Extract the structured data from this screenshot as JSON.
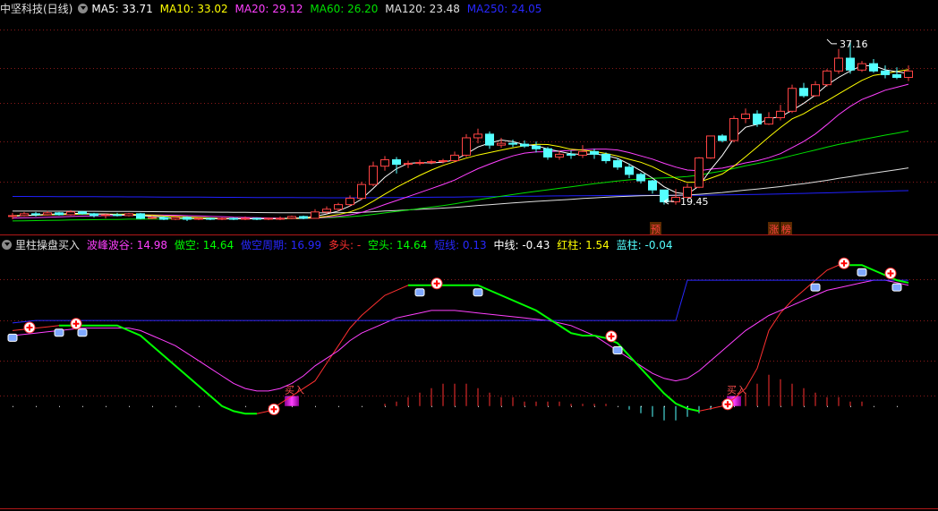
{
  "colors": {
    "background": "#000000",
    "grid": "#8b1a1a",
    "up": "#ff4444",
    "down": "#54ffff",
    "ma5": "#ffffff",
    "ma10": "#ffff00",
    "ma20": "#ff40ff",
    "ma60": "#00e000",
    "ma120": "#e0e0e0",
    "ma250": "#2020ff"
  },
  "top_header": {
    "title": "中坚科技(日线)",
    "ma5": "MA5: 33.71",
    "ma10": "MA10: 33.02",
    "ma20": "MA20: 29.12",
    "ma60": "MA60: 26.20",
    "ma120": "MA120: 23.48",
    "ma250": "MA250: 24.05"
  },
  "bottom_header": {
    "title": "里柱操盘买入",
    "i1": "波峰波谷: 14.98",
    "i2": "做空: 14.64",
    "i3": "做空周期: 16.99",
    "i4": "多头: -",
    "i5": "空头: 14.64",
    "i6": "短线: 0.13",
    "i7": "中线: -0.43",
    "i8": "红柱: 1.54",
    "i9": "蓝柱: -0.04"
  },
  "labels": {
    "high": "37.16",
    "low": "19.45",
    "yu": "预",
    "zhang": "涨",
    "bang": "榜",
    "buy": "买入"
  },
  "chart_data": [
    {
      "type": "candlestick",
      "title": "中坚科技(日线)",
      "ylim": [
        17.5,
        39.5
      ],
      "days": 78,
      "candles": [
        [
          17.8,
          17.9,
          17.5,
          18.2
        ],
        [
          17.9,
          18.1,
          17.8,
          18.3
        ],
        [
          18.1,
          18.0,
          17.8,
          18.3
        ],
        [
          18.0,
          18.2,
          17.9,
          18.4
        ],
        [
          18.2,
          18.0,
          17.9,
          18.3
        ],
        [
          18.0,
          18.3,
          17.9,
          18.5
        ],
        [
          18.3,
          18.1,
          18.0,
          18.4
        ],
        [
          18.1,
          17.9,
          17.7,
          18.2
        ],
        [
          17.9,
          18.0,
          17.6,
          18.1
        ],
        [
          18.0,
          17.9,
          17.8,
          18.2
        ],
        [
          17.9,
          18.1,
          17.8,
          18.2
        ],
        [
          18.1,
          17.6,
          17.5,
          18.2
        ],
        [
          17.6,
          17.7,
          17.5,
          17.9
        ],
        [
          17.7,
          17.5,
          17.4,
          17.8
        ],
        [
          17.5,
          17.7,
          17.4,
          17.9
        ],
        [
          17.7,
          17.5,
          17.3,
          17.8
        ],
        [
          17.5,
          17.6,
          17.4,
          17.7
        ],
        [
          17.6,
          17.5,
          17.4,
          17.7
        ],
        [
          17.5,
          17.6,
          17.4,
          17.7
        ],
        [
          17.6,
          17.5,
          17.4,
          17.7
        ],
        [
          17.5,
          17.6,
          17.4,
          17.8
        ],
        [
          17.6,
          17.5,
          17.4,
          17.7
        ],
        [
          17.5,
          17.6,
          17.4,
          17.7
        ],
        [
          17.6,
          17.6,
          17.4,
          17.8
        ],
        [
          17.6,
          17.8,
          17.5,
          17.9
        ],
        [
          17.8,
          17.6,
          17.5,
          17.9
        ],
        [
          17.6,
          18.3,
          17.6,
          18.6
        ],
        [
          18.3,
          18.6,
          18.1,
          18.9
        ],
        [
          18.6,
          19.1,
          18.4,
          19.3
        ],
        [
          19.1,
          19.8,
          18.9,
          20.1
        ],
        [
          19.8,
          21.3,
          19.6,
          21.6
        ],
        [
          21.3,
          23.3,
          21.1,
          23.8
        ],
        [
          23.3,
          24.0,
          22.8,
          24.4
        ],
        [
          24.0,
          23.5,
          22.5,
          24.3
        ],
        [
          23.5,
          23.6,
          23.1,
          23.9
        ],
        [
          23.6,
          23.7,
          23.4,
          24.0
        ],
        [
          23.7,
          23.8,
          23.5,
          24.0
        ],
        [
          23.8,
          23.9,
          23.6,
          24.1
        ],
        [
          23.9,
          24.5,
          23.7,
          24.9
        ],
        [
          24.5,
          26.4,
          24.3,
          26.8
        ],
        [
          26.4,
          26.8,
          25.8,
          27.4
        ],
        [
          26.8,
          25.6,
          25.2,
          27.1
        ],
        [
          25.6,
          25.8,
          25.3,
          26.4
        ],
        [
          25.8,
          25.7,
          25.4,
          26.2
        ],
        [
          25.7,
          25.5,
          25.3,
          26.1
        ],
        [
          25.5,
          25.2,
          24.8,
          26.0
        ],
        [
          25.2,
          24.3,
          24.0,
          25.4
        ],
        [
          24.3,
          24.6,
          24.0,
          25.0
        ],
        [
          24.6,
          24.5,
          24.1,
          25.0
        ],
        [
          24.5,
          24.9,
          24.2,
          25.6
        ],
        [
          24.9,
          24.6,
          24.1,
          25.2
        ],
        [
          24.6,
          23.9,
          23.6,
          24.8
        ],
        [
          23.9,
          23.2,
          22.9,
          24.2
        ],
        [
          23.2,
          22.4,
          22.0,
          23.6
        ],
        [
          22.4,
          21.7,
          21.4,
          22.6
        ],
        [
          21.7,
          20.7,
          20.3,
          21.8
        ],
        [
          20.7,
          19.4,
          19.1,
          20.7
        ],
        [
          19.4,
          19.9,
          19.1,
          20.8
        ],
        [
          19.9,
          21.0,
          19.8,
          21.4
        ],
        [
          21.0,
          24.2,
          20.9,
          24.3
        ],
        [
          24.2,
          26.6,
          24.1,
          26.6
        ],
        [
          26.6,
          26.1,
          25.9,
          26.8
        ],
        [
          26.1,
          28.5,
          25.9,
          28.8
        ],
        [
          28.5,
          29.0,
          28.0,
          29.6
        ],
        [
          29.0,
          27.9,
          27.6,
          29.4
        ],
        [
          27.9,
          28.6,
          27.8,
          29.2
        ],
        [
          28.6,
          29.3,
          28.3,
          30.0
        ],
        [
          29.3,
          31.8,
          29.1,
          32.2
        ],
        [
          31.8,
          31.0,
          30.8,
          32.4
        ],
        [
          31.0,
          32.2,
          30.9,
          32.6
        ],
        [
          32.2,
          33.7,
          32.0,
          33.9
        ],
        [
          33.7,
          35.1,
          33.4,
          36.1
        ],
        [
          35.1,
          33.8,
          33.4,
          36.9
        ],
        [
          33.8,
          34.5,
          33.6,
          34.8
        ],
        [
          34.5,
          33.7,
          33.5,
          35.0
        ],
        [
          33.7,
          33.3,
          32.9,
          34.3
        ],
        [
          33.3,
          33.0,
          32.8,
          34.1
        ],
        [
          33.0,
          33.7,
          32.6,
          34.3
        ]
      ],
      "ma_start_values": {
        "ma5": 17.8,
        "ma10": 17.9,
        "ma20": 17.6,
        "ma60": 17.3,
        "ma120": 18.4,
        "ma250": 20.0
      },
      "annotations": {
        "high": {
          "day": 70,
          "value": 37.16
        },
        "low": {
          "day": 56,
          "value": 19.45
        }
      }
    },
    {
      "type": "indicator",
      "title": "里柱操盘买入",
      "days": 78,
      "ylim": [
        -20,
        60
      ],
      "series": [
        {
          "name": "波峰波谷",
          "color": "#ff3030",
          "values": [
            30,
            30.5,
            31,
            31.5,
            32,
            32,
            32,
            32,
            32,
            32,
            30,
            28,
            24,
            20,
            16,
            12,
            8,
            4,
            0,
            -2,
            -3,
            -3,
            -2,
            1,
            4,
            7,
            10,
            17,
            24,
            31,
            36,
            40,
            44,
            46,
            48,
            48,
            48,
            48,
            48,
            48,
            48,
            46,
            44,
            42,
            40,
            38,
            35,
            32,
            29,
            28,
            28,
            27,
            25,
            20,
            15,
            10,
            5,
            1,
            -1,
            -2,
            -1,
            0,
            3,
            7,
            15,
            30,
            37,
            42,
            46,
            50,
            54,
            56,
            56,
            56,
            54,
            52,
            50,
            49
          ]
        },
        {
          "name": "做空",
          "color": "#ff40ff",
          "values": [
            28,
            28.5,
            29,
            29.5,
            30,
            30.5,
            31,
            31,
            31,
            31,
            31,
            30,
            28,
            26,
            24,
            21,
            18,
            15,
            12,
            9,
            7,
            6,
            6,
            7,
            9,
            12,
            16,
            19,
            22,
            26,
            29,
            31,
            33,
            35,
            36,
            37,
            38,
            38,
            38,
            37.5,
            37,
            36.5,
            36,
            35.5,
            35,
            34.5,
            34,
            33,
            32,
            30,
            28,
            25,
            22,
            19,
            16,
            13,
            11,
            10,
            11,
            14,
            18,
            22,
            26,
            30,
            33,
            36,
            38,
            40,
            42,
            44,
            46,
            47,
            48,
            49,
            50,
            50,
            49,
            48
          ]
        },
        {
          "name": "做空周期",
          "color": "#2828ff",
          "values": [
            33,
            33.5,
            34,
            34,
            34,
            34,
            34,
            34,
            34,
            34,
            34,
            34,
            34,
            34,
            34,
            34,
            34,
            34,
            34,
            34,
            34,
            34,
            34,
            34,
            34,
            34,
            34,
            34,
            34,
            34,
            34,
            34,
            34,
            34,
            34,
            34,
            34,
            34,
            34,
            34,
            34,
            34,
            34,
            34,
            34,
            34,
            34,
            34,
            34,
            34,
            34,
            34,
            34,
            34,
            34,
            34,
            34,
            34,
            50,
            50,
            50,
            50,
            50,
            50,
            50,
            50,
            50,
            50,
            50,
            50,
            50,
            50,
            50,
            50,
            50,
            50,
            50,
            50
          ]
        },
        {
          "name": "多头",
          "color": "#00ff00",
          "values": []
        }
      ],
      "bars": [
        {
          "name": "红柱",
          "color": "#ff3030",
          "values": [
            0,
            0,
            0,
            0,
            0,
            0,
            0,
            0,
            0,
            0,
            0,
            0,
            0,
            0,
            0,
            0,
            0,
            0,
            0,
            0,
            0,
            0,
            0,
            0,
            0,
            0,
            0,
            0,
            0,
            0,
            0,
            0,
            0.5,
            1,
            2,
            3,
            4,
            5,
            5,
            5,
            4,
            3,
            2,
            2,
            1,
            1,
            1,
            1,
            0.5,
            0.5,
            0.5,
            0.5,
            0,
            0,
            0,
            0,
            0,
            0,
            0,
            0,
            0,
            1,
            2,
            3,
            5,
            7,
            6,
            5,
            4,
            3,
            2,
            2,
            1,
            1,
            0,
            0,
            0,
            0
          ]
        },
        {
          "name": "蓝柱",
          "color": "#54ffff",
          "values": [
            0,
            0,
            0,
            0,
            0,
            0,
            0,
            0,
            0,
            0,
            0,
            0,
            0,
            0,
            0,
            0,
            0,
            0,
            0,
            0,
            0,
            0,
            0,
            0,
            0,
            0,
            0,
            0,
            0,
            0,
            0,
            0,
            0,
            0,
            0,
            0,
            0,
            0,
            0,
            0,
            0,
            0,
            0,
            0,
            0,
            0,
            0,
            0,
            0,
            0,
            0,
            0,
            0,
            1,
            2,
            3,
            4,
            4,
            3,
            2,
            1,
            0,
            0,
            0,
            0,
            0,
            0,
            0,
            0,
            0,
            0,
            0,
            0,
            0,
            0,
            0,
            0,
            0
          ]
        }
      ],
      "markers": {
        "buy_cross_days": [
          1,
          5,
          22,
          36,
          51,
          61,
          71,
          75
        ],
        "cup_days": [
          0,
          4,
          6,
          35,
          40,
          52,
          69,
          73,
          76
        ],
        "buy_bar_days": [
          24,
          62
        ]
      }
    }
  ]
}
